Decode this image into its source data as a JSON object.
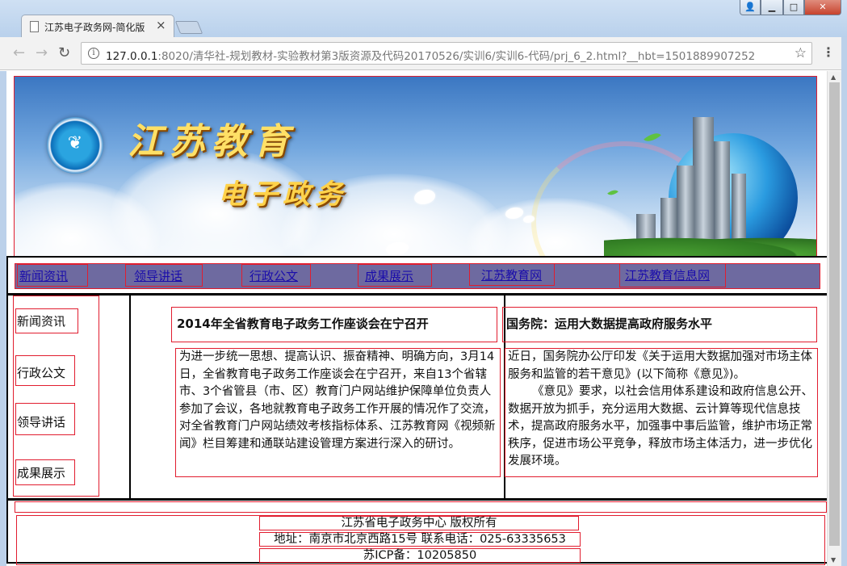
{
  "browser": {
    "tab_title": "江苏电子政务网-简化版",
    "tab_close": "×",
    "url_host": "127.0.0.1",
    "url_rest": ":8020/清华社-规划教材-实验教材第3版资源及代码20170526/实训6/实训6-代码/prj_6_2.html?__hbt=1501889907252",
    "back_icon": "←",
    "forward_icon": "→",
    "reload_icon": "↻",
    "info_icon": "i",
    "star_icon": "☆",
    "menu_icon": "⋮",
    "user_icon": "👤",
    "min_icon": "▁",
    "max_icon": "□",
    "close_icon": "✕"
  },
  "banner": {
    "title_main": "江苏教育",
    "title_sub": "电子政务",
    "emblem_icon": "emblem-icon"
  },
  "nav": {
    "items": [
      {
        "label": "新闻资讯"
      },
      {
        "label": "领导讲话"
      },
      {
        "label": "行政公文"
      },
      {
        "label": "成果展示"
      },
      {
        "label": "江苏教育网"
      },
      {
        "label": "江苏教育信息网"
      }
    ]
  },
  "sidebar": {
    "items": [
      {
        "label": "新闻资讯"
      },
      {
        "label": "行政公文"
      },
      {
        "label": "领导讲话"
      },
      {
        "label": "成果展示"
      }
    ]
  },
  "articles": [
    {
      "title": "2014年全省教育电子政务工作座谈会在宁召开",
      "body": "为进一步统一思想、提高认识、振奋精神、明确方向，3月14日，全省教育电子政务工作座谈会在宁召开，来自13个省辖市、3个省管县（市、区）教育门户网站维护保障单位负责人参加了会议，各地就教育电子政务工作开展的情况作了交流，对全省教育门户网站绩效考核指标体系、江苏教育网《视频新闻》栏目筹建和通联站建设管理方案进行深入的研讨。"
    },
    {
      "title": "国务院：运用大数据提高政府服务水平",
      "body": "近日，国务院办公厅印发《关于运用大数据加强对市场主体服务和监管的若干意见》(以下简称《意见》)。",
      "body2": "《意见》要求，以社会信用体系建设和政府信息公开、数据开放为抓手，充分运用大数据、云计算等现代信息技术，提高政府服务水平，加强事中事后监管，维护市场正常秩序，促进市场公平竞争，释放市场主体活力，进一步优化发展环境。"
    }
  ],
  "footer": {
    "copyright": "江苏省电子政务中心  版权所有",
    "address": "地址：南京市北京西路15号 联系电话：025-63335653",
    "icp": "苏ICP备：10205850"
  },
  "colors": {
    "nav_bg": "#6e6aa0",
    "link": "#1a0dab",
    "debug_border": "#e11d2f",
    "frame_border": "#000000"
  }
}
